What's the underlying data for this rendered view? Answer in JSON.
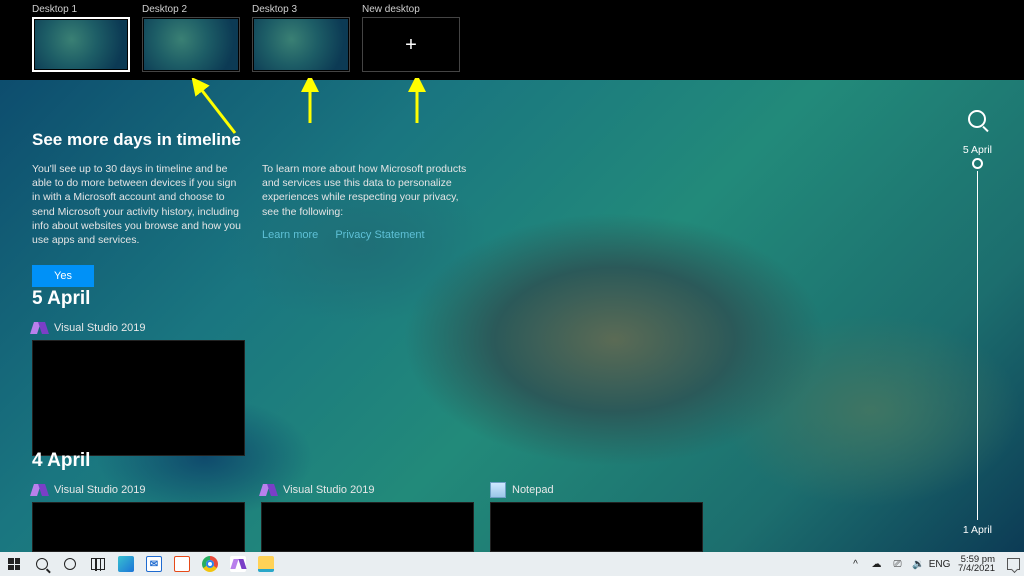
{
  "desktops": {
    "d1": "Desktop 1",
    "d2": "Desktop 2",
    "d3": "Desktop 3",
    "new": "New desktop"
  },
  "info": {
    "title": "See more days in timeline",
    "left": "You'll see up to 30 days in timeline and be able to do more between devices if you sign in with a Microsoft account and choose to send Microsoft your activity history, including info about websites you browse and how you use apps and services.",
    "right": "To learn more about how Microsoft products and services use this data to personalize experiences while respecting your privacy, see the following:",
    "learn": "Learn more",
    "privacy": "Privacy Statement",
    "yes": "Yes"
  },
  "sections": {
    "d1": {
      "label": "5 April",
      "app1": "Visual Studio 2019"
    },
    "d2": {
      "label": "4 April",
      "app1": "Visual Studio 2019",
      "app2": "Visual Studio 2019",
      "app3": "Notepad"
    }
  },
  "rail": {
    "top": "5 April",
    "bottom": "1 April"
  },
  "tray": {
    "lang": "ENG",
    "time": "5:59 pm",
    "date": "7/4/2021"
  }
}
